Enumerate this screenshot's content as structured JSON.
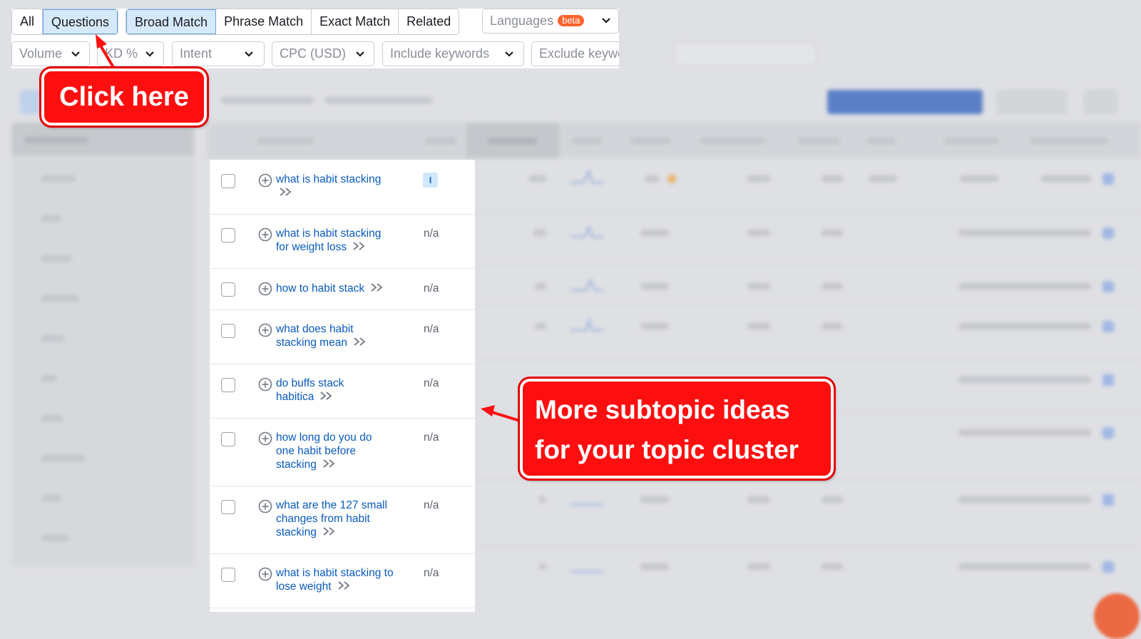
{
  "tabs": [
    {
      "label": "All",
      "active": false
    },
    {
      "label": "Questions",
      "active": true
    }
  ],
  "match_tabs": [
    {
      "label": "Broad Match",
      "active": true
    },
    {
      "label": "Phrase Match",
      "active": false
    },
    {
      "label": "Exact Match",
      "active": false
    },
    {
      "label": "Related",
      "active": false
    }
  ],
  "languages": {
    "label": "Languages",
    "badge": "beta"
  },
  "filters": {
    "volume": "Volume",
    "kd": "KD %",
    "intent": "Intent",
    "cpc": "CPC (USD)",
    "include": "Include keywords",
    "exclude": "Exclude keywords"
  },
  "keywords": [
    {
      "text": "what is habit stacking",
      "intent": "I"
    },
    {
      "text": "what is habit stacking for weight loss",
      "intent": "n/a"
    },
    {
      "text": "how to habit stack",
      "intent": "n/a"
    },
    {
      "text": "what does habit stacking mean",
      "intent": "n/a"
    },
    {
      "text": "do buffs stack habitica",
      "intent": "n/a"
    },
    {
      "text": "how long do you do one habit before stacking",
      "intent": "n/a"
    },
    {
      "text": "what are the 127 small changes from habit stacking",
      "intent": "n/a"
    },
    {
      "text": "what is habit stacking to lose weight",
      "intent": "n/a"
    }
  ],
  "annotations": {
    "click_here": "Click here",
    "subtopic_line1": "More subtopic ideas",
    "subtopic_line2": "for your topic cluster"
  },
  "colors": {
    "accent_blue": "#0a5bbd",
    "active_tab_bg": "#d6e9fb",
    "callout_red": "#fd0f0f",
    "beta_orange": "#ff642d"
  }
}
